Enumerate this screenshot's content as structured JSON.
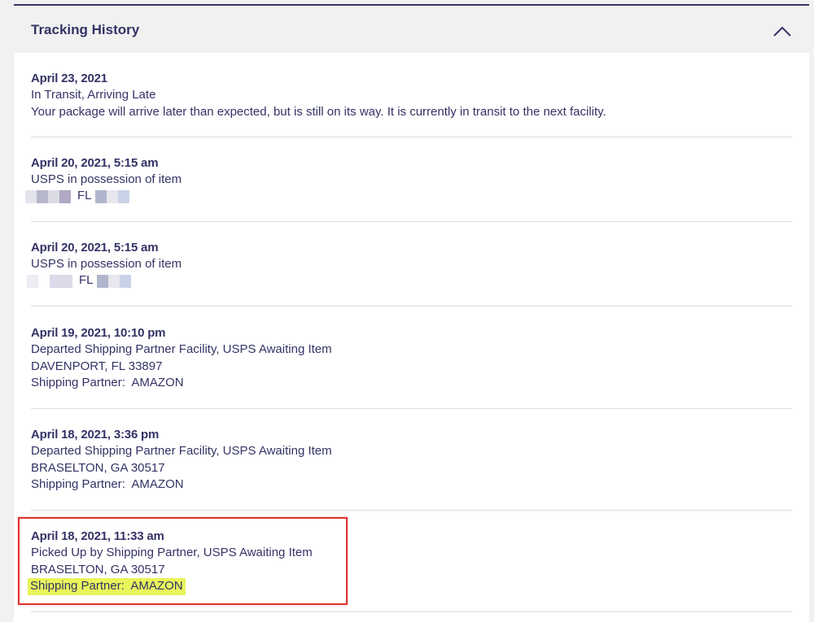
{
  "panel": {
    "title": "Tracking History",
    "collapse_icon": "chevron-up-icon"
  },
  "events": [
    {
      "date": "April 23, 2021",
      "status": "In Transit, Arriving Late",
      "detail": "Your package will arrive later than expected, but is still on its way. It is currently in transit to the next facility."
    },
    {
      "date": "April 20, 2021, 5:15 am",
      "status": "USPS in possession of item",
      "location_state": "FL"
    },
    {
      "date": "April 20, 2021, 5:15 am",
      "status": "USPS in possession of item",
      "location_state": "FL"
    },
    {
      "date": "April 19, 2021, 10:10 pm",
      "status": "Departed Shipping Partner Facility, USPS Awaiting Item",
      "location": "DAVENPORT, FL 33897",
      "partner": "Shipping Partner:  AMAZON"
    },
    {
      "date": "April 18, 2021, 3:36 pm",
      "status": "Departed Shipping Partner Facility, USPS Awaiting Item",
      "location": "BRASELTON, GA 30517",
      "partner": "Shipping Partner:  AMAZON"
    },
    {
      "date": "April 18, 2021, 11:33 am",
      "status": "Picked Up by Shipping Partner, USPS Awaiting Item",
      "location": "BRASELTON, GA 30517",
      "partner": "Shipping Partner:  AMAZON"
    }
  ],
  "colors": {
    "text": "#333366",
    "highlight": "#e9f55a",
    "annotation_box": "#e0322c"
  }
}
